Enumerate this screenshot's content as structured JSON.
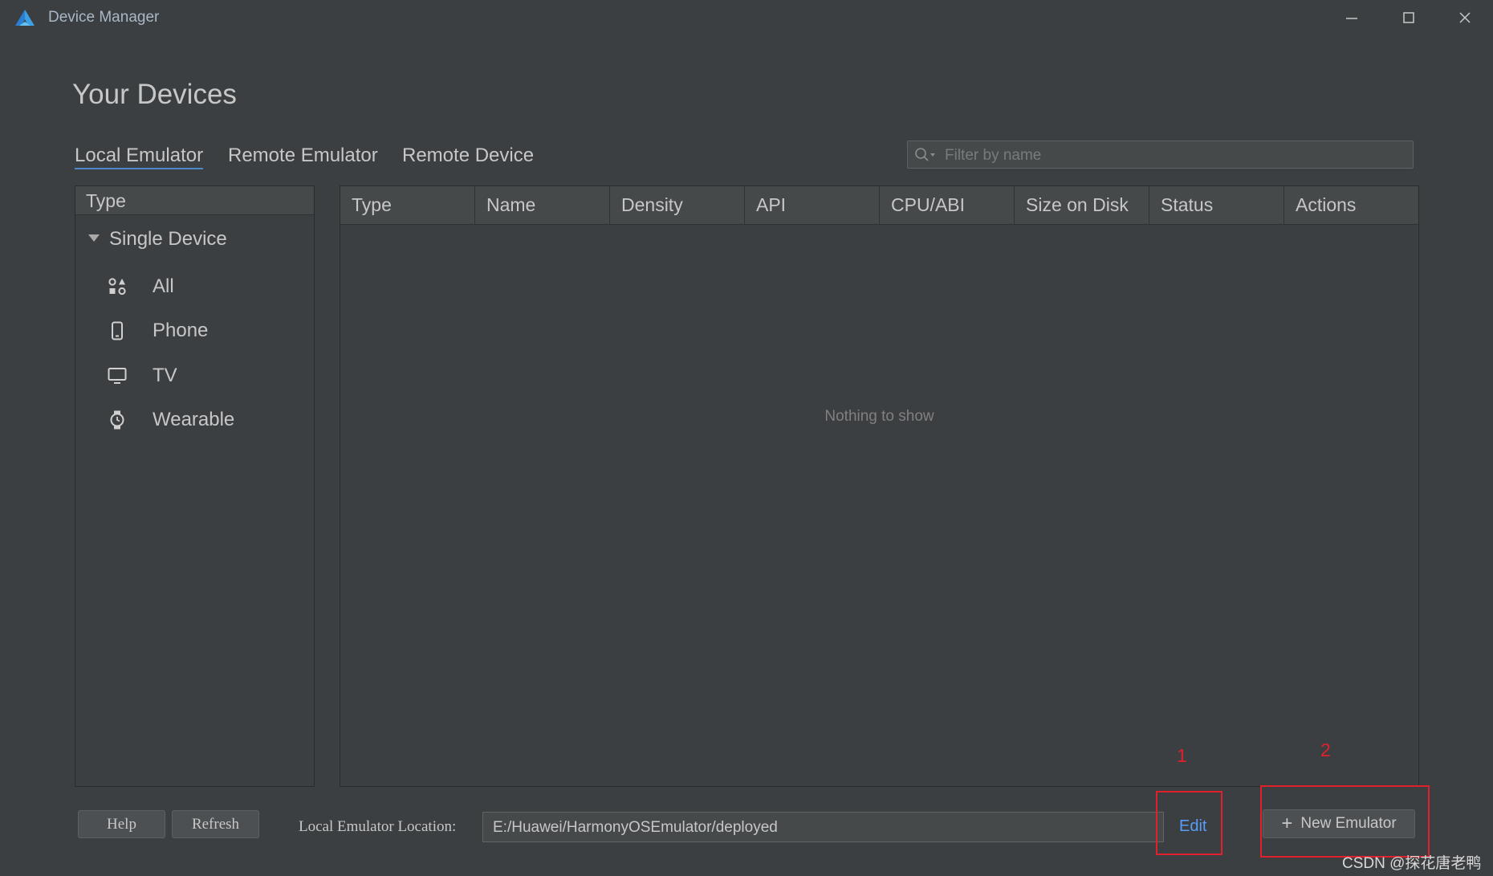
{
  "window": {
    "title": "Device Manager",
    "controls": {
      "minimize": "minimize-icon",
      "maximize": "maximize-icon",
      "close": "close-icon"
    }
  },
  "page": {
    "title": "Your Devices"
  },
  "tabs": [
    {
      "label": "Local Emulator",
      "active": true
    },
    {
      "label": "Remote Emulator",
      "active": false
    },
    {
      "label": "Remote Device",
      "active": false
    }
  ],
  "filter": {
    "placeholder": "Filter by name",
    "value": "",
    "icon": "search-icon"
  },
  "type_panel": {
    "header": "Type",
    "group": "Single Device",
    "items": [
      {
        "label": "All",
        "icon": "grid-shapes-icon"
      },
      {
        "label": "Phone",
        "icon": "phone-icon"
      },
      {
        "label": "TV",
        "icon": "tv-icon"
      },
      {
        "label": "Wearable",
        "icon": "watch-icon"
      }
    ]
  },
  "table": {
    "columns": [
      "Type",
      "Name",
      "Density",
      "API",
      "CPU/ABI",
      "Size on Disk",
      "Status",
      "Actions"
    ],
    "rows": [],
    "empty_text": "Nothing to show"
  },
  "footer": {
    "help_label": "Help",
    "refresh_label": "Refresh",
    "location_label": "Local Emulator Location:",
    "location_value": "E:/Huawei/HarmonyOSEmulator/deployed",
    "edit_label": "Edit",
    "new_emulator_label": "New Emulator"
  },
  "annotations": {
    "marker_1": "1",
    "marker_2": "2",
    "color": "#e0202b"
  },
  "watermark": "CSDN @探花唐老鸭",
  "colors": {
    "background": "#3c3f41",
    "accent": "#4a88c7",
    "link": "#589df6"
  }
}
